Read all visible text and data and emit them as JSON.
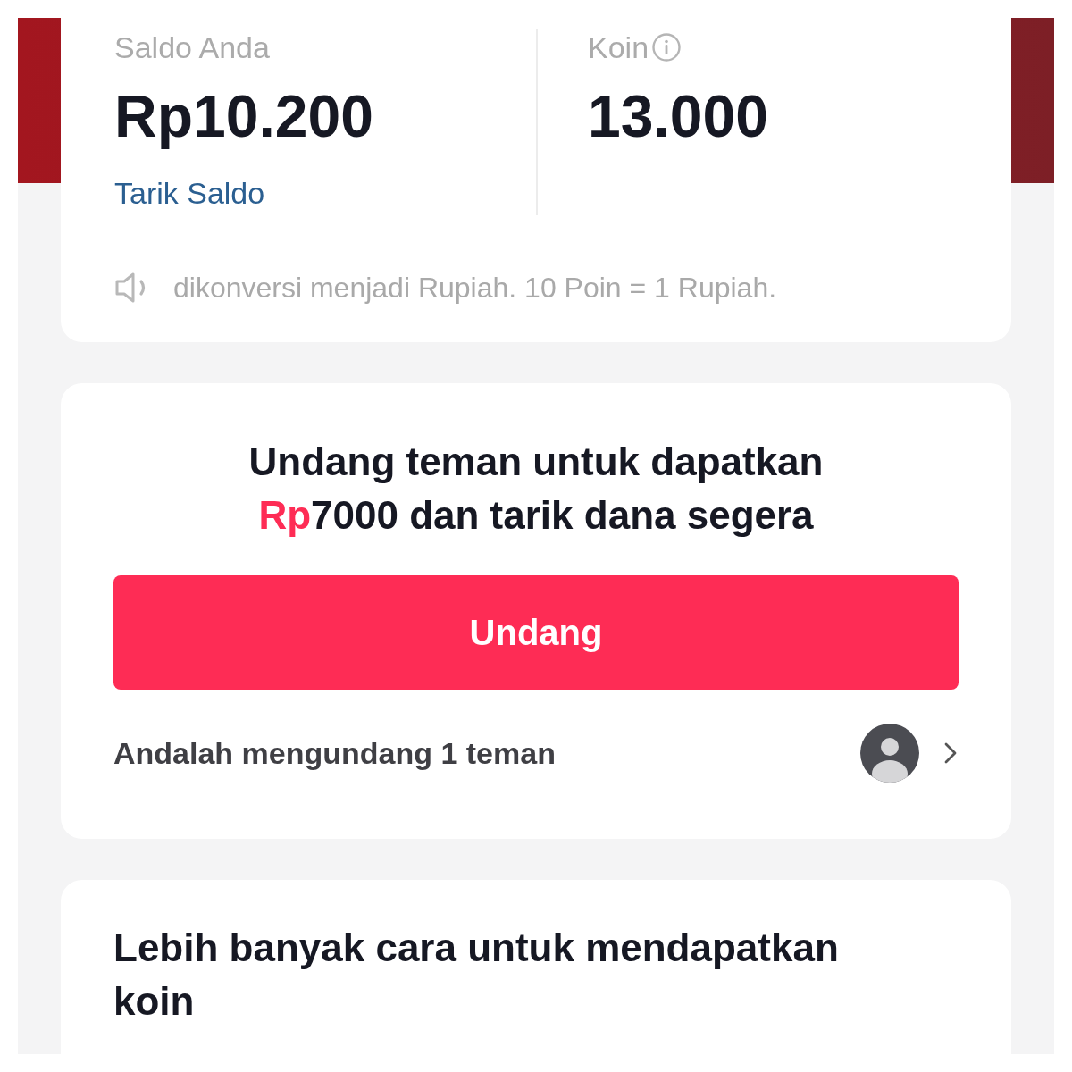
{
  "balance": {
    "label": "Saldo Anda",
    "amount": "Rp10.200",
    "link": "Tarik Saldo"
  },
  "coins": {
    "label": "Koin",
    "amount": "13.000"
  },
  "notice": {
    "text": "dikonversi menjadi Rupiah. 10 Poin = 1 Rupiah."
  },
  "invite": {
    "title_lines": [
      [
        {
          "text": "Undang teman untuk dapatkan",
          "highlight": false
        }
      ],
      [
        {
          "text": "Rp",
          "highlight": true
        },
        {
          "text": "7000 dan tarik dana segera",
          "highlight": false
        }
      ]
    ],
    "button": "Undang",
    "invited_text": "Andalah mengundang 1 teman"
  },
  "more_ways": {
    "title": "Lebih banyak cara untuk mendapatkan koin"
  }
}
